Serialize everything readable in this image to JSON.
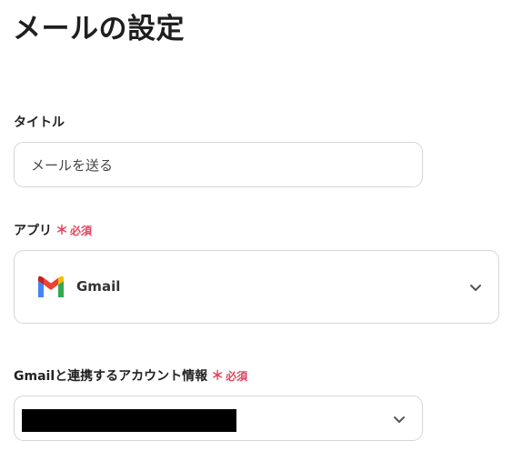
{
  "page": {
    "title": "メールの設定"
  },
  "fields": {
    "title": {
      "label": "タイトル",
      "value": "メールを送る"
    },
    "app": {
      "label": "アプリ",
      "required_mark": "＊",
      "required_text": "必須",
      "selected_app": "Gmail",
      "app_icon": "gmail-logo"
    },
    "account": {
      "label": "Gmailと連携するアカウント情報",
      "required_mark": "＊",
      "required_text": "必須"
    }
  },
  "colors": {
    "required": "#e3435f",
    "border": "#d6d6d6",
    "text": "#222222"
  }
}
